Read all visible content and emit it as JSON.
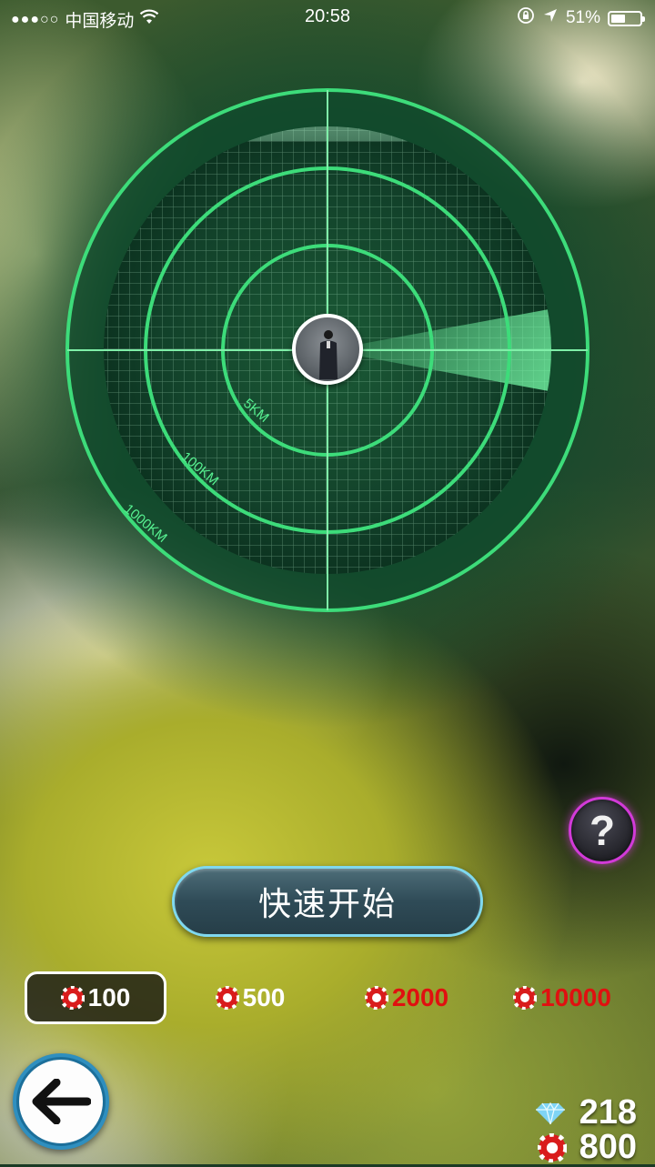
{
  "status_bar": {
    "signal_dots": "●●●○○",
    "carrier": "中国移动",
    "time": "20:58",
    "battery_percent": "51%",
    "battery_level": 0.51,
    "icons": [
      "wifi-icon",
      "orientation-lock-icon",
      "location-arrow-icon",
      "battery-icon"
    ]
  },
  "radar": {
    "ring_labels": [
      "5KM",
      "100KM",
      "1000KM"
    ],
    "accent_color": "#3ddc7a"
  },
  "help_button": {
    "label": "?",
    "border_color": "#d23ad8"
  },
  "quick_start": {
    "label": "快速开始"
  },
  "bets": [
    {
      "label": "100",
      "selected": true,
      "color": "#ffffff"
    },
    {
      "label": "500",
      "selected": false,
      "color": "#ffffff"
    },
    {
      "label": "2000",
      "selected": false,
      "color": "#e01010"
    },
    {
      "label": "10000",
      "selected": false,
      "color": "#e01010"
    }
  ],
  "currency": {
    "gems": "218",
    "coins": "800"
  },
  "back_button": {
    "icon": "arrow-left-icon"
  }
}
